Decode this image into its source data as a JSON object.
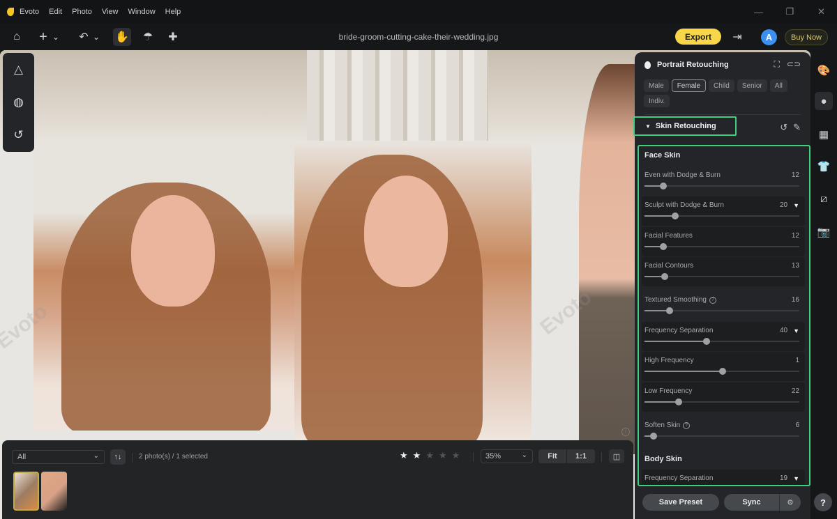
{
  "app": {
    "name": "Evoto",
    "menu": [
      "Evoto",
      "Edit",
      "Photo",
      "View",
      "Window",
      "Help"
    ],
    "filename": "bride-groom-cutting-cake-their-wedding.jpg"
  },
  "window_controls": {
    "minimize": "—",
    "restore": "❐",
    "close": "✕"
  },
  "toolbar": {
    "home_icon": "⌂",
    "add_icon": "+",
    "chevron": "⌄",
    "undo_icon": "↶",
    "hand_icon": "✋",
    "brush_icon": "☂",
    "bandage_icon": "✚",
    "export_label": "Export",
    "import_icon": "⇥",
    "avatar_letter": "A",
    "buy_now_label": "Buy Now"
  },
  "left_tools": {
    "adjust_icon": "△",
    "mask_icon": "◍",
    "history_icon": "↺"
  },
  "canvas": {
    "watermark": "Evoto",
    "info_icon": "i"
  },
  "bottom": {
    "filter_value": "All",
    "sort_icon": "↑↓",
    "count_text": "2 photo(s) / 1 selected",
    "rating": 2,
    "rating_max": 5,
    "zoom_value": "35%",
    "fit_label": "Fit",
    "one_to_one_label": "1:1",
    "compare_icon": "◫"
  },
  "panel": {
    "title": "Portrait Retouching",
    "chips": [
      {
        "label": "Male",
        "selected": false
      },
      {
        "label": "Female",
        "selected": true
      },
      {
        "label": "Child",
        "selected": false
      },
      {
        "label": "Senior",
        "selected": false
      },
      {
        "label": "All",
        "selected": false
      },
      {
        "label": "Indiv.",
        "selected": false
      }
    ],
    "section_title": "Skin Retouching",
    "reset_icon": "↺",
    "edit_icon": "✎",
    "face_skin_title": "Face Skin",
    "body_skin_title": "Body Skin",
    "face_sliders": [
      {
        "label": "Even with Dodge & Burn",
        "value": 12,
        "dropdown": false,
        "help": false,
        "dark": false,
        "position": 0.12
      },
      {
        "label": "Sculpt with Dodge & Burn",
        "value": 20,
        "dropdown": true,
        "help": false,
        "dark": true,
        "position": 0.2
      },
      {
        "label": "Facial Features",
        "value": 12,
        "dropdown": false,
        "help": false,
        "dark": true,
        "position": 0.12
      },
      {
        "label": "Facial Contours",
        "value": 13,
        "dropdown": false,
        "help": false,
        "dark": true,
        "position": 0.13
      },
      {
        "label": "Textured Smoothing",
        "value": 16,
        "dropdown": false,
        "help": true,
        "dark": false,
        "position": 0.16
      },
      {
        "label": "Frequency Separation",
        "value": 40,
        "dropdown": true,
        "help": false,
        "dark": true,
        "position": 0.4
      },
      {
        "label": "High Frequency",
        "value": 1,
        "dropdown": false,
        "help": false,
        "dark": true,
        "position": 0.505
      },
      {
        "label": "Low Frequency",
        "value": 22,
        "dropdown": false,
        "help": false,
        "dark": true,
        "position": 0.22
      },
      {
        "label": "Soften Skin",
        "value": 6,
        "dropdown": false,
        "help": true,
        "dark": false,
        "position": 0.06
      }
    ],
    "body_sliders": [
      {
        "label": "Frequency Separation",
        "value": 19,
        "dropdown": true
      }
    ],
    "save_preset_label": "Save Preset",
    "sync_label": "Sync",
    "sync_settings_icon": "⊙"
  },
  "right_bar": {
    "items": [
      "palette-icon",
      "portrait-icon",
      "background-icon",
      "clothing-icon",
      "crop-icon",
      "camera-icon"
    ],
    "glyphs": [
      "🎨",
      "●",
      "▦",
      "👕",
      "⧄",
      "📷"
    ],
    "active": 1,
    "help_label": "?"
  },
  "colors": {
    "accent_green": "#3fcf7d",
    "export_yellow": "#f7d649",
    "avatar_blue": "#3d8ff0"
  }
}
